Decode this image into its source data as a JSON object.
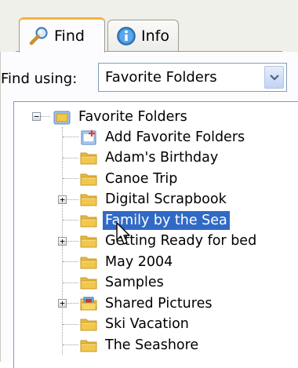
{
  "tabs": [
    {
      "label": "Find",
      "icon": "find-icon",
      "active": true
    },
    {
      "label": "Info",
      "icon": "info-icon",
      "active": false
    }
  ],
  "find_using": {
    "label": "Find using:",
    "value": "Favorite Folders"
  },
  "tree": {
    "root": {
      "label": "Favorite Folders",
      "expanded": true
    },
    "items": [
      {
        "label": "Add Favorite Folders",
        "icon": "add-folder-icon",
        "expandable": false
      },
      {
        "label": "Adam's Birthday",
        "icon": "folder-icon",
        "expandable": false
      },
      {
        "label": "Canoe Trip",
        "icon": "folder-icon",
        "expandable": false
      },
      {
        "label": "Digital Scrapbook",
        "icon": "folder-icon",
        "expandable": true
      },
      {
        "label": "Family by the Sea",
        "icon": "folder-icon",
        "expandable": false,
        "selected": true
      },
      {
        "label": "Getting Ready for bed",
        "icon": "folder-icon",
        "expandable": true
      },
      {
        "label": "May 2004",
        "icon": "folder-icon",
        "expandable": false
      },
      {
        "label": "Samples",
        "icon": "folder-icon",
        "expandable": false
      },
      {
        "label": "Shared Pictures",
        "icon": "shared-folder-icon",
        "expandable": true
      },
      {
        "label": "Ski Vacation",
        "icon": "folder-icon",
        "expandable": false
      },
      {
        "label": "The Seashore",
        "icon": "folder-icon",
        "expandable": false
      }
    ]
  },
  "colors": {
    "selection": "#316ac5",
    "tab_accent": "#f4b43e",
    "folder": "#f2c74a"
  }
}
